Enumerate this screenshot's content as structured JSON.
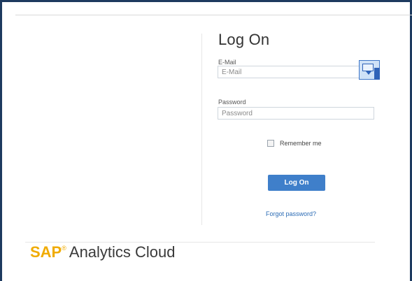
{
  "logon": {
    "title": "Log On",
    "email_label": "E-Mail",
    "email_placeholder": "E-Mail",
    "password_label": "Password",
    "password_placeholder": "Password",
    "remember_label": "Remember me",
    "remember_checked": false,
    "submit_label": "Log On",
    "forgot_link": "Forgot password?"
  },
  "brand": {
    "sap": "SAP",
    "registered": "®",
    "product": "Analytics Cloud"
  },
  "icons": {
    "password_helper": "password-manager-icon"
  },
  "colors": {
    "accent": "#3f7fca",
    "brand": "#f0ab00",
    "link": "#2c6cb5"
  }
}
